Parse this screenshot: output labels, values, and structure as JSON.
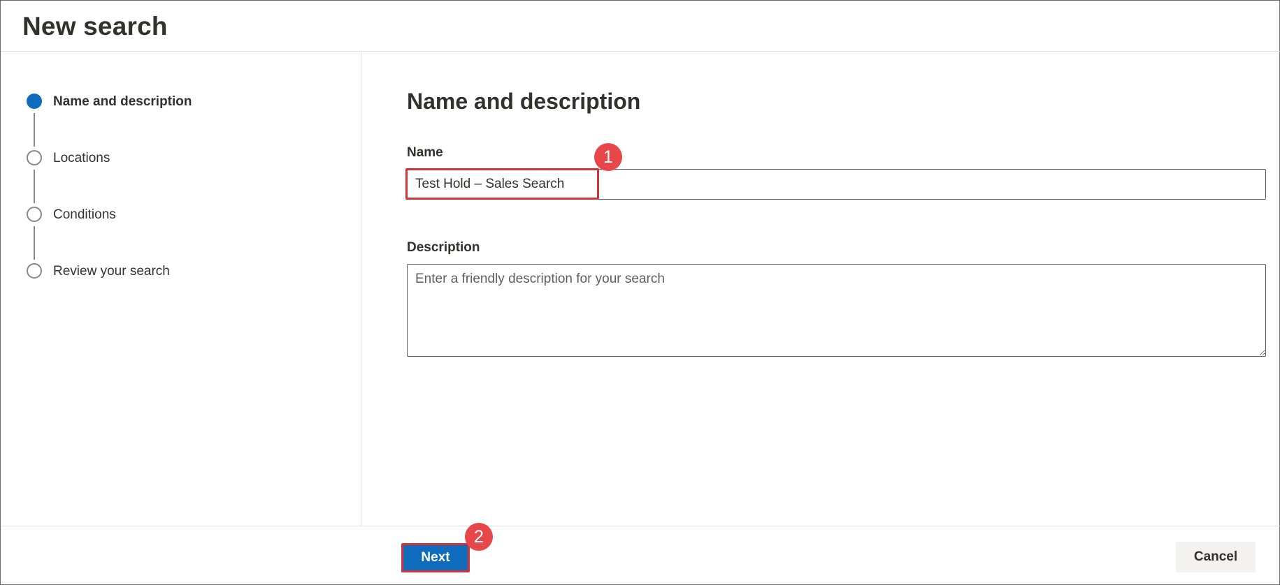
{
  "page": {
    "title": "New search"
  },
  "wizard": {
    "steps": [
      {
        "label": "Name and description",
        "state": "current"
      },
      {
        "label": "Locations",
        "state": "pending"
      },
      {
        "label": "Conditions",
        "state": "pending"
      },
      {
        "label": "Review your search",
        "state": "pending"
      }
    ]
  },
  "form": {
    "section_title": "Name and description",
    "name_label": "Name",
    "name_value": "Test Hold – Sales Search",
    "description_label": "Description",
    "description_placeholder": "Enter a friendly description for your search"
  },
  "footer": {
    "next_label": "Next",
    "cancel_label": "Cancel"
  },
  "annotations": {
    "badge_1": "1",
    "badge_2": "2"
  },
  "colors": {
    "accent": "#0f6cbd",
    "annotation_red": "#d13438",
    "badge_red": "#e8474a"
  }
}
